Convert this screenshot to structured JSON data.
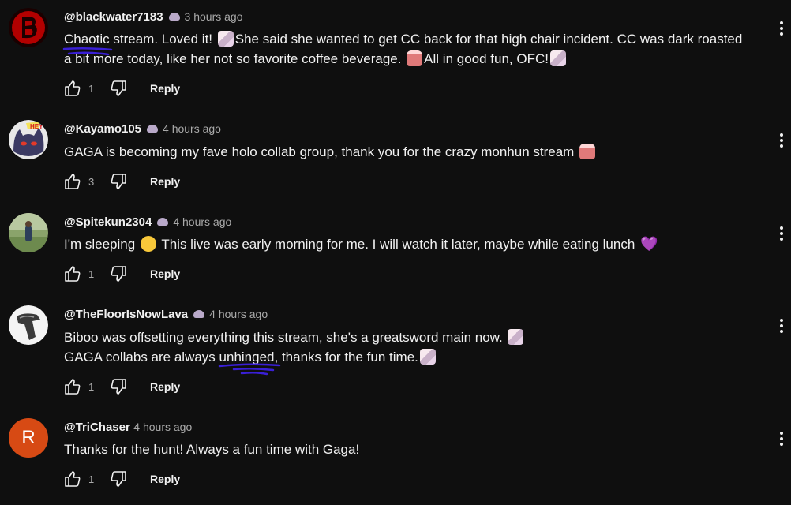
{
  "comments": [
    {
      "author": "@blackwater7183",
      "time": "3 hours ago",
      "lines": [
        [
          "Chaotic",
          " stream. Loved it! ",
          "She said she wanted to get CC back for that high chair incident. CC was dark roasted"
        ],
        [
          "a bit more today, like her not so favorite coffee beverage. ",
          "All in good fun, OFC!"
        ]
      ],
      "likes": "1",
      "reply": "Reply"
    },
    {
      "author": "@Kayamo105",
      "time": "4 hours ago",
      "lines": [
        [
          "GAGA is becoming my fave holo collab group, thank you for the crazy monhun stream "
        ]
      ],
      "likes": "3",
      "reply": "Reply"
    },
    {
      "author": "@Spitekun2304",
      "time": "4 hours ago",
      "lines": [
        [
          "I'm sleeping ",
          " This live was early morning for me. I will watch it later, maybe while eating lunch "
        ]
      ],
      "likes": "1",
      "reply": "Reply"
    },
    {
      "author": "@TheFloorIsNowLava",
      "time": "4 hours ago",
      "lines": [
        [
          "Biboo was offsetting everything this stream, she's a greatsword main now. "
        ],
        [
          "GAGA collabs are always ",
          "unhinged",
          ", thanks for the fun time."
        ]
      ],
      "likes": "1",
      "reply": "Reply"
    },
    {
      "author": "@TriChaser",
      "time": "4 hours ago",
      "avatar_letter": "R",
      "lines": [
        [
          "Thanks for the hunt! Always a fun time with Gaga!"
        ]
      ],
      "likes": "1",
      "reply": "Reply"
    }
  ],
  "emoji": {
    "heart": "💜"
  },
  "icons": [
    "thumb-up-icon",
    "thumb-down-icon",
    "more-vert-icon",
    "member-badge-icon",
    "custom-emoji-icon"
  ],
  "colors": {
    "background": "#0f0f0f",
    "text": "#f1f1f1",
    "muted": "#aaaaaa",
    "scribble": "#3a1fd6",
    "avatar_letter_bg": "#d74a14"
  }
}
